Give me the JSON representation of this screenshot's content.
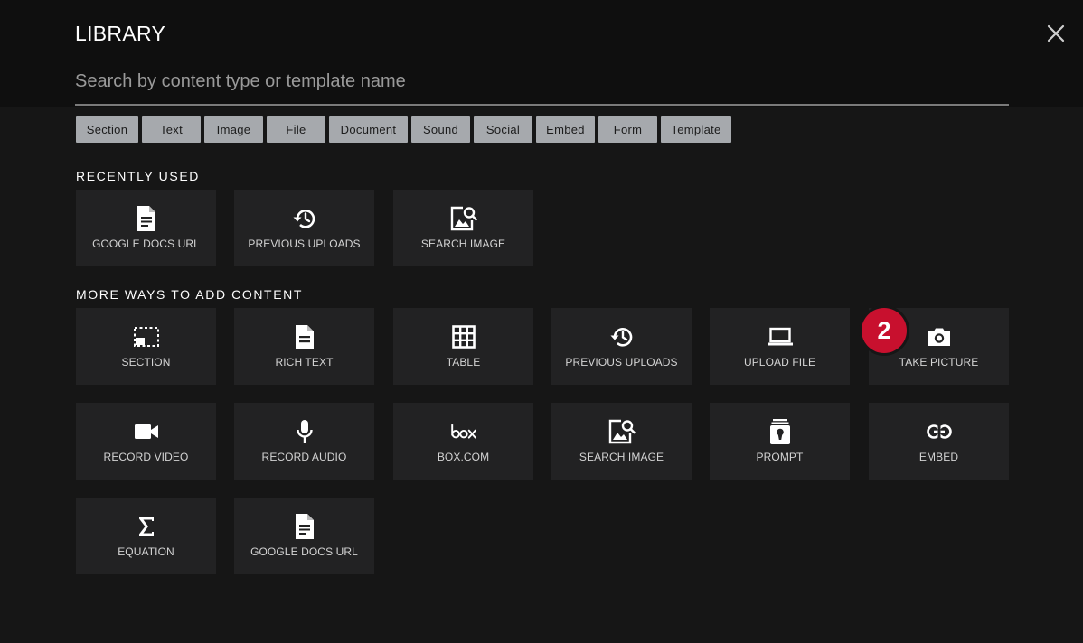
{
  "header": {
    "title": "LIBRARY",
    "search_placeholder": "Search by content type or template name",
    "close_icon": "close-icon"
  },
  "filters": [
    "Section",
    "Text",
    "Image",
    "File",
    "Document",
    "Sound",
    "Social",
    "Embed",
    "Form",
    "Template"
  ],
  "recently_used": {
    "label": "RECENTLY USED",
    "items": [
      {
        "label": "GOOGLE DOCS URL",
        "icon": "document-icon"
      },
      {
        "label": "PREVIOUS UPLOADS",
        "icon": "history-icon"
      },
      {
        "label": "SEARCH IMAGE",
        "icon": "image-search-icon"
      }
    ]
  },
  "more_ways": {
    "label": "MORE WAYS TO ADD CONTENT",
    "items": [
      {
        "label": "SECTION",
        "icon": "section-icon"
      },
      {
        "label": "RICH TEXT",
        "icon": "rich-text-icon"
      },
      {
        "label": "TABLE",
        "icon": "table-icon"
      },
      {
        "label": "PREVIOUS UPLOADS",
        "icon": "history-icon"
      },
      {
        "label": "UPLOAD FILE",
        "icon": "laptop-icon"
      },
      {
        "label": "TAKE PICTURE",
        "icon": "camera-icon"
      },
      {
        "label": "RECORD VIDEO",
        "icon": "video-camera-icon"
      },
      {
        "label": "RECORD AUDIO",
        "icon": "microphone-icon"
      },
      {
        "label": "BOX.COM",
        "icon": "box-logo-icon"
      },
      {
        "label": "SEARCH IMAGE",
        "icon": "image-search-icon"
      },
      {
        "label": "PROMPT",
        "icon": "prompt-icon"
      },
      {
        "label": "EMBED",
        "icon": "link-icon"
      },
      {
        "label": "EQUATION",
        "icon": "sigma-icon"
      },
      {
        "label": "GOOGLE DOCS URL",
        "icon": "document-icon"
      }
    ]
  },
  "step_badge": "2",
  "colors": {
    "background": "#161616",
    "header_band": "#0f0f0f",
    "tile": "#222223",
    "chip": "#a6a9ad",
    "badge": "#c8102e"
  }
}
